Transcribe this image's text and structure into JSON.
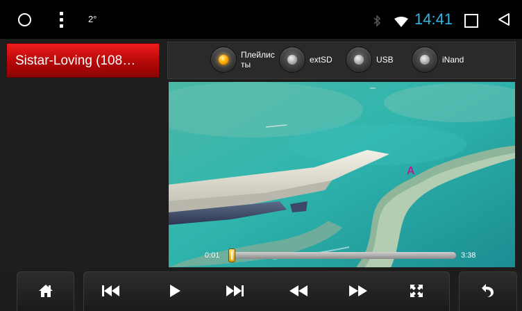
{
  "status_bar": {
    "notification_text": "2°",
    "time": "14:41",
    "icons": [
      "circle-icon",
      "overflow-menu-icon",
      "bluetooth-icon",
      "wifi-icon",
      "recents-icon",
      "back-icon"
    ]
  },
  "playlist": {
    "current_track": "Sistar-Loving (108…"
  },
  "sources": [
    {
      "label": "Плейлис\nты",
      "selected": true
    },
    {
      "label": "extSD",
      "selected": false
    },
    {
      "label": "USB",
      "selected": false
    },
    {
      "label": "iNand",
      "selected": false
    }
  ],
  "video": {
    "overlay_letter": "A"
  },
  "seek": {
    "elapsed": "0:01",
    "duration": "3:38",
    "progress": 0.005
  },
  "controls": {
    "icons": [
      "home-icon",
      "previous-icon",
      "play-icon",
      "next-icon",
      "rewind-icon",
      "fast-forward-icon",
      "fullscreen-icon",
      "return-icon"
    ]
  },
  "colors": {
    "accent": "#33b5e5",
    "selected_track": "#d81010",
    "selected_source": "#ffa000",
    "seek_thumb": "#f0c030"
  }
}
